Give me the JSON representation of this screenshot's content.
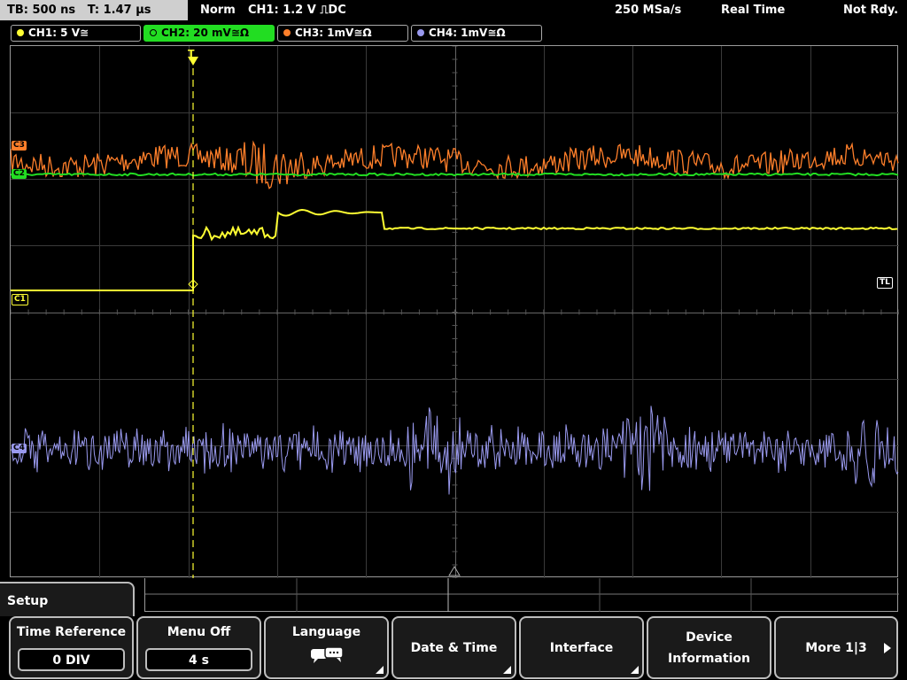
{
  "status": {
    "timebase": "TB: 500 ns",
    "trigger_time": "T: 1.47 µs",
    "mode": "Norm",
    "trigger": "CH1: 1.2 V ⎍DC",
    "sample_rate": "250 MSa/s",
    "acq_mode": "Real Time",
    "state": "Not Rdy."
  },
  "channels": [
    {
      "label": "CH1: 5 V≅",
      "color": "#ffff33"
    },
    {
      "label": "CH2: 20 mV≅Ω",
      "color": "#22dd22"
    },
    {
      "label": "CH3: 1mV≅Ω",
      "color": "#ff7f2a"
    },
    {
      "label": "CH4: 1mV≅Ω",
      "color": "#9999ee"
    }
  ],
  "markers": {
    "c3": "C3",
    "c2": "C2",
    "c1": "C1",
    "c4": "C4",
    "trigger_level": "TL",
    "trigger_pos": "T"
  },
  "menu": {
    "title": "Setup",
    "softkeys": [
      {
        "label": "Time Reference",
        "value": "0 DIV"
      },
      {
        "label": "Menu Off",
        "value": "4 s"
      },
      {
        "label": "Language",
        "icon": "speech-bubble-icon"
      },
      {
        "label": "Date & Time"
      },
      {
        "label": "Interface"
      },
      {
        "label_line1": "Device",
        "label_line2": "Information"
      },
      {
        "label": "More 1|3"
      }
    ]
  }
}
